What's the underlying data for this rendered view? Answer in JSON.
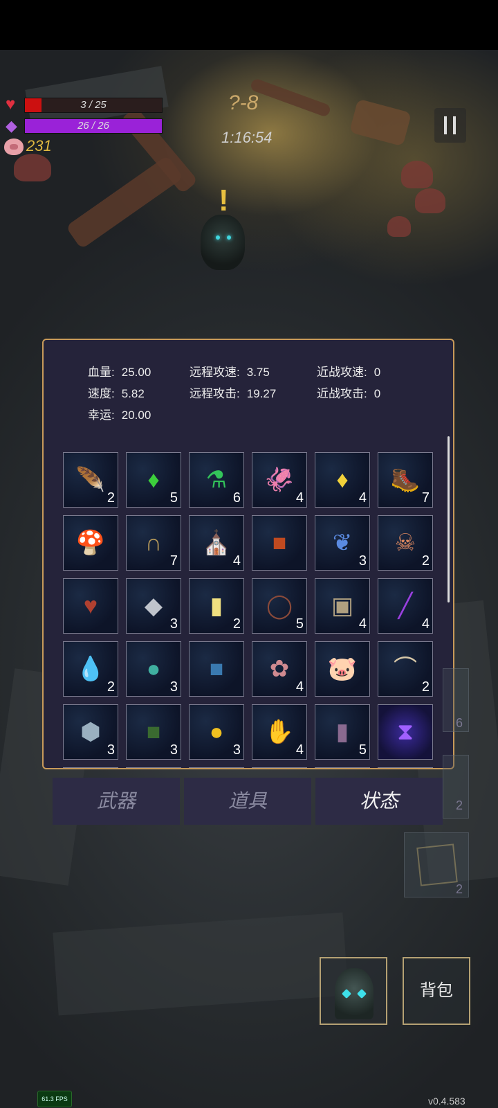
{
  "hud": {
    "hp_text": "3 / 25",
    "hp_fraction": 0.12,
    "mp_text": "26 / 26",
    "mp_fraction": 1.0,
    "coins": "231",
    "wave": "?-8",
    "timer": "1:16:54",
    "icons": {
      "hp": "heart-icon",
      "mp": "diamond-icon",
      "coins": "piggy-bank-icon",
      "pause": "pause-icon"
    },
    "colors": {
      "hp": "#cc1010",
      "mp": "#9a22d8",
      "coins": "#e0b840"
    }
  },
  "stats": {
    "row1": [
      {
        "label": "血量:",
        "value": "25.00"
      },
      {
        "label": "远程攻速:",
        "value": "3.75"
      },
      {
        "label": "近战攻速:",
        "value": "0"
      }
    ],
    "row2": [
      {
        "label": "速度:",
        "value": "5.82"
      },
      {
        "label": "远程攻击:",
        "value": "19.27"
      },
      {
        "label": "近战攻击:",
        "value": "0"
      }
    ],
    "row3": [
      {
        "label": "幸运:",
        "value": "20.00"
      }
    ]
  },
  "items": [
    {
      "icon": "feather-icon",
      "count": "2"
    },
    {
      "icon": "green-crystal-icon",
      "count": "5"
    },
    {
      "icon": "green-potion-icon",
      "count": "6"
    },
    {
      "icon": "squid-icon",
      "count": "4"
    },
    {
      "icon": "yellow-crystal-icon",
      "count": "4"
    },
    {
      "icon": "boots-icon",
      "count": "7"
    },
    {
      "icon": "mushroom-icon",
      "count": ""
    },
    {
      "icon": "horseshoe-icon",
      "count": "7"
    },
    {
      "icon": "cloak-icon",
      "count": "4"
    },
    {
      "icon": "demon-book-icon",
      "count": ""
    },
    {
      "icon": "dragonfly-icon",
      "count": "3"
    },
    {
      "icon": "feathered-skull-icon",
      "count": "2"
    },
    {
      "icon": "burning-heart-icon",
      "count": ""
    },
    {
      "icon": "silver-ore-icon",
      "count": "3"
    },
    {
      "icon": "yellow-card-icon",
      "count": "2"
    },
    {
      "icon": "thorn-crown-icon",
      "count": "5"
    },
    {
      "icon": "ore-chunks-icon",
      "count": "4"
    },
    {
      "icon": "purple-wand-icon",
      "count": "4"
    },
    {
      "icon": "water-drop-icon",
      "count": "2"
    },
    {
      "icon": "rainbow-orb-icon",
      "count": "3"
    },
    {
      "icon": "blue-tome-icon",
      "count": ""
    },
    {
      "icon": "flower-bunch-icon",
      "count": "4"
    },
    {
      "icon": "piggy-bank-icon",
      "count": ""
    },
    {
      "icon": "horn-icon",
      "count": "2"
    },
    {
      "icon": "stone-icon",
      "count": "3"
    },
    {
      "icon": "skull-book-icon",
      "count": "3"
    },
    {
      "icon": "gold-coin-icon",
      "count": "3"
    },
    {
      "icon": "gloves-icon",
      "count": "4"
    },
    {
      "icon": "purple-boots-icon",
      "count": "5"
    },
    {
      "icon": "hourglass-rune-icon",
      "count": ""
    }
  ],
  "tabs": [
    {
      "label": "武器",
      "active": false
    },
    {
      "label": "道具",
      "active": false
    },
    {
      "label": "状态",
      "active": true
    }
  ],
  "side": {
    "num_top": "6",
    "num_mid": "2",
    "num_box": "2"
  },
  "buttons": {
    "bag": "背包"
  },
  "fps": "61.3 FPS",
  "version": "v0.4.583"
}
